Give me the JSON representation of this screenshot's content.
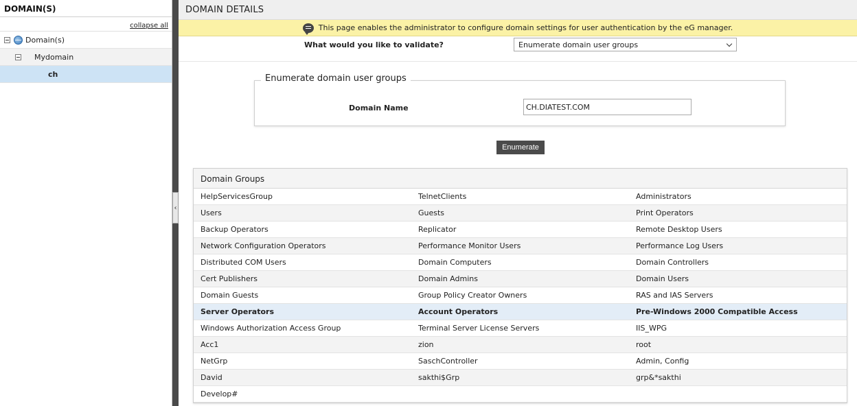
{
  "sidebar": {
    "title": "DOMAIN(S)",
    "collapse_label": "collapse all",
    "tree": [
      {
        "label": "Domain(s)"
      },
      {
        "label": "Mydomain"
      },
      {
        "label": "ch"
      }
    ]
  },
  "main": {
    "title": "DOMAIN DETAILS",
    "info_text": "This page enables the administrator to configure domain settings for user authentication by the eG manager.",
    "validate_label": "What would you like to validate?",
    "validate_value": "Enumerate domain user groups",
    "fieldset_legend": "Enumerate domain user groups",
    "domain_name_label": "Domain Name",
    "domain_name_value": "CH.DIATEST.COM",
    "enumerate_label": "Enumerate"
  },
  "groups": {
    "title": "Domain Groups",
    "rows": [
      [
        "HelpServicesGroup",
        "TelnetClients",
        "Administrators"
      ],
      [
        "Users",
        "Guests",
        "Print Operators"
      ],
      [
        "Backup Operators",
        "Replicator",
        "Remote Desktop Users"
      ],
      [
        "Network Configuration Operators",
        "Performance Monitor Users",
        "Performance Log Users"
      ],
      [
        "Distributed COM Users",
        "Domain Computers",
        "Domain Controllers"
      ],
      [
        "Cert Publishers",
        "Domain Admins",
        "Domain Users"
      ],
      [
        "Domain Guests",
        "Group Policy Creator Owners",
        "RAS and IAS Servers"
      ],
      [
        "Server Operators",
        "Account Operators",
        "Pre-Windows 2000 Compatible Access"
      ],
      [
        "Windows Authorization Access Group",
        "Terminal Server License Servers",
        "IIS_WPG"
      ],
      [
        "Acc1",
        "zion",
        "root"
      ],
      [
        "NetGrp",
        "SaschController",
        "Admin, Config"
      ],
      [
        "David",
        "sakthi$Grp",
        "grp&*sakthi"
      ],
      [
        "Develop#",
        "",
        ""
      ]
    ]
  }
}
